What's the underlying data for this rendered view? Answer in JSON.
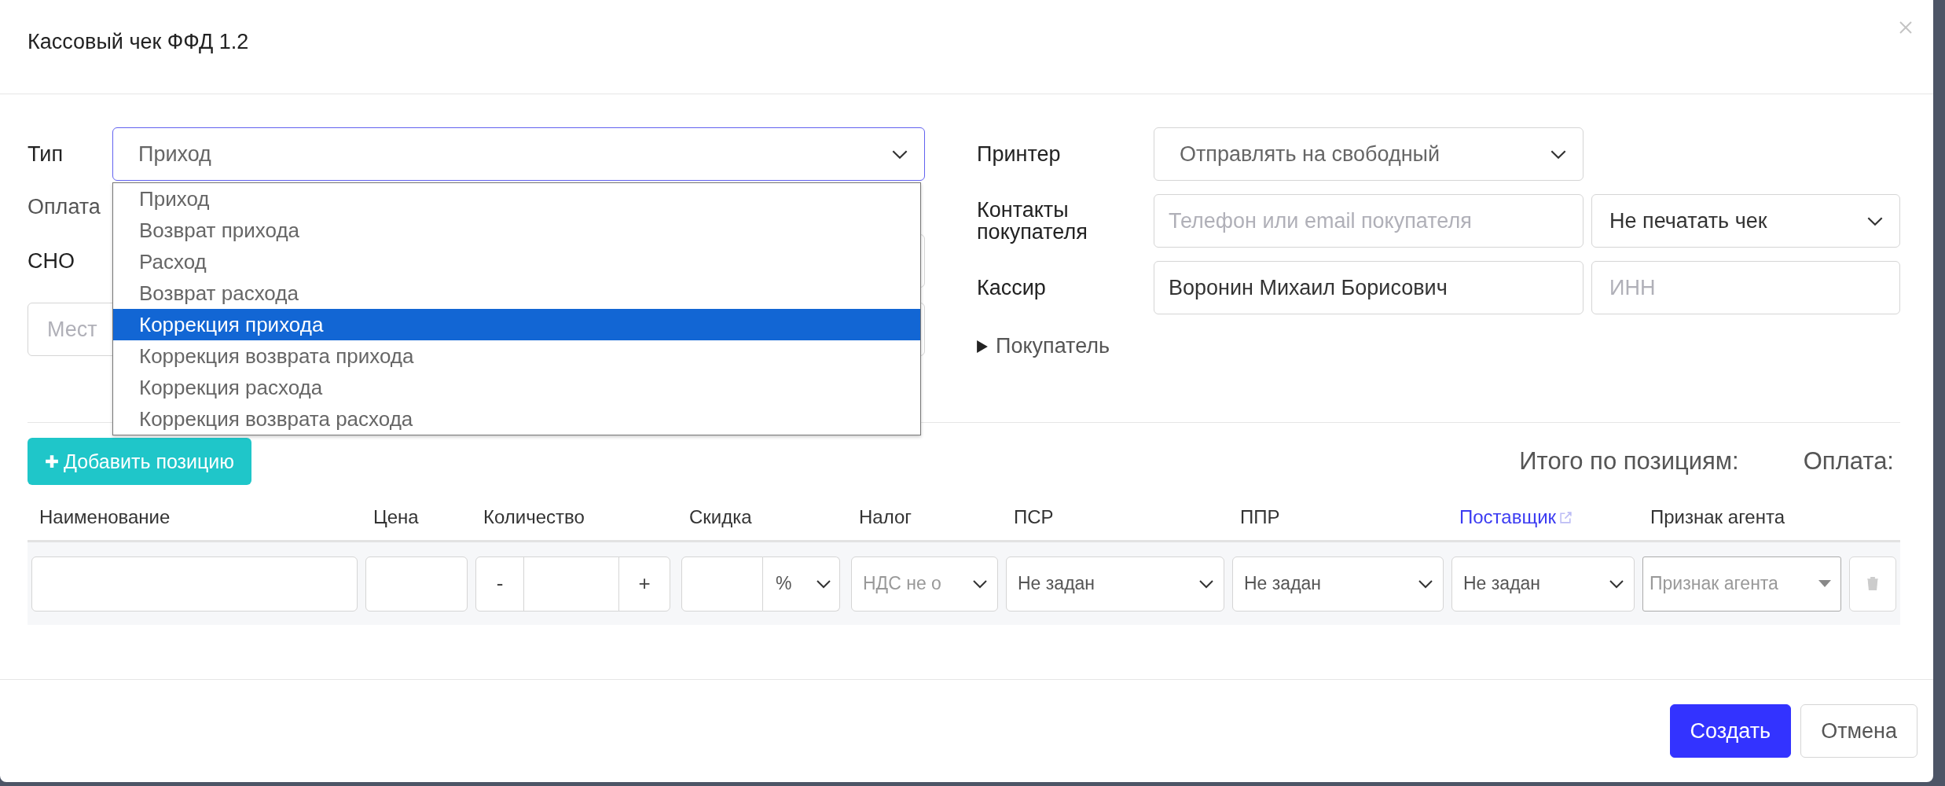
{
  "dialog": {
    "title": "Кассовый чек ФФД 1.2"
  },
  "left": {
    "type": {
      "label": "Тип",
      "value": "Приход",
      "expanded": true,
      "options": [
        {
          "label": "Приход",
          "highlighted": false
        },
        {
          "label": "Возврат прихода",
          "highlighted": false
        },
        {
          "label": "Расход",
          "highlighted": false
        },
        {
          "label": "Возврат расхода",
          "highlighted": false
        },
        {
          "label": "Коррекция прихода",
          "highlighted": true
        },
        {
          "label": "Коррекция возврата прихода",
          "highlighted": false
        },
        {
          "label": "Коррекция расхода",
          "highlighted": false
        },
        {
          "label": "Коррекция возврата расхода",
          "highlighted": false
        }
      ]
    },
    "payment": {
      "label": "Оплата"
    },
    "sno": {
      "label": "СНО"
    },
    "place": {
      "placeholder": "Мест"
    }
  },
  "right": {
    "printer": {
      "label": "Принтер",
      "value": "Отправлять на свободный"
    },
    "contacts": {
      "label": "Контакты покупателя",
      "placeholder": "Телефон или email покупателя",
      "print_mode": "Не печатать чек"
    },
    "cashier": {
      "label": "Кассир",
      "value": "Воронин Михаил Борисович",
      "inn_placeholder": "ИНН"
    },
    "buyer": {
      "label": "Покупатель",
      "expanded": false
    }
  },
  "add_position_button": "Добавить позицию",
  "totals": [
    "Итого по позициям:",
    "Оплата:"
  ],
  "table": {
    "columns": [
      {
        "label": "Наименование",
        "kind": "text"
      },
      {
        "label": "Цена",
        "kind": "text"
      },
      {
        "label": "Количество",
        "kind": "text"
      },
      {
        "label": "Скидка",
        "kind": "text"
      },
      {
        "label": "Налог",
        "kind": "text"
      },
      {
        "label": "ПСР",
        "kind": "text"
      },
      {
        "label": "ППР",
        "kind": "text"
      },
      {
        "label": "Поставщик",
        "kind": "link"
      },
      {
        "label": "Признак агента",
        "kind": "text"
      }
    ],
    "row": {
      "minus": "-",
      "plus": "+",
      "discount_unit": "%",
      "tax": "НДС не о",
      "psr": "Не задан",
      "ppr": "Не задан",
      "supplier": "Не задан",
      "agent_placeholder": "Признак агента"
    }
  },
  "footer_buttons": [
    {
      "label": "Создать",
      "kind": "primary"
    },
    {
      "label": "Отмена",
      "kind": "secondary"
    }
  ]
}
